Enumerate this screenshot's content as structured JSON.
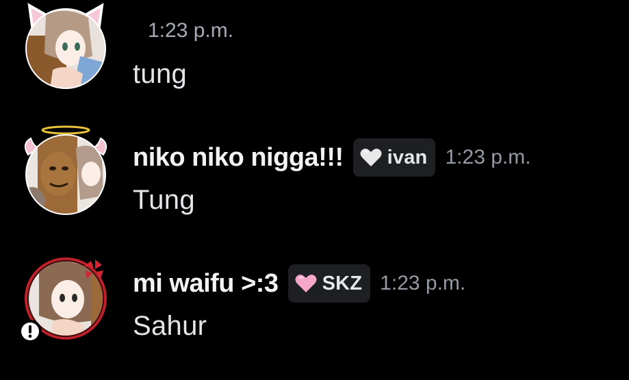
{
  "messages": [
    {
      "avatar_icon": "anime-cat-ears-avatar-icon",
      "timestamp": "1:23 p.m.",
      "content": "tung"
    },
    {
      "avatar_icon": "anime-halo-avatar-icon",
      "username": "niko niko nigga!!!",
      "tag_icon": "white-heart-icon",
      "tag_label": "ivan",
      "timestamp": "1:23 p.m.",
      "content": "Tung"
    },
    {
      "avatar_icon": "anime-anger-avatar-icon",
      "status_icon": "alert-status-icon",
      "username": "mi waifu >:3",
      "tag_icon": "pink-heart-icon",
      "tag_label": "SKZ",
      "timestamp": "1:23 p.m.",
      "content": "Sahur"
    }
  ],
  "colors": {
    "background": "#000000",
    "username": "#f2f3f5",
    "timestamp": "#949ba4",
    "badge_background": "#1e1f22",
    "white_heart": "#e8e8e8",
    "pink_heart": "#f4a7c9",
    "avatar_ring_red": "#c0202a"
  }
}
